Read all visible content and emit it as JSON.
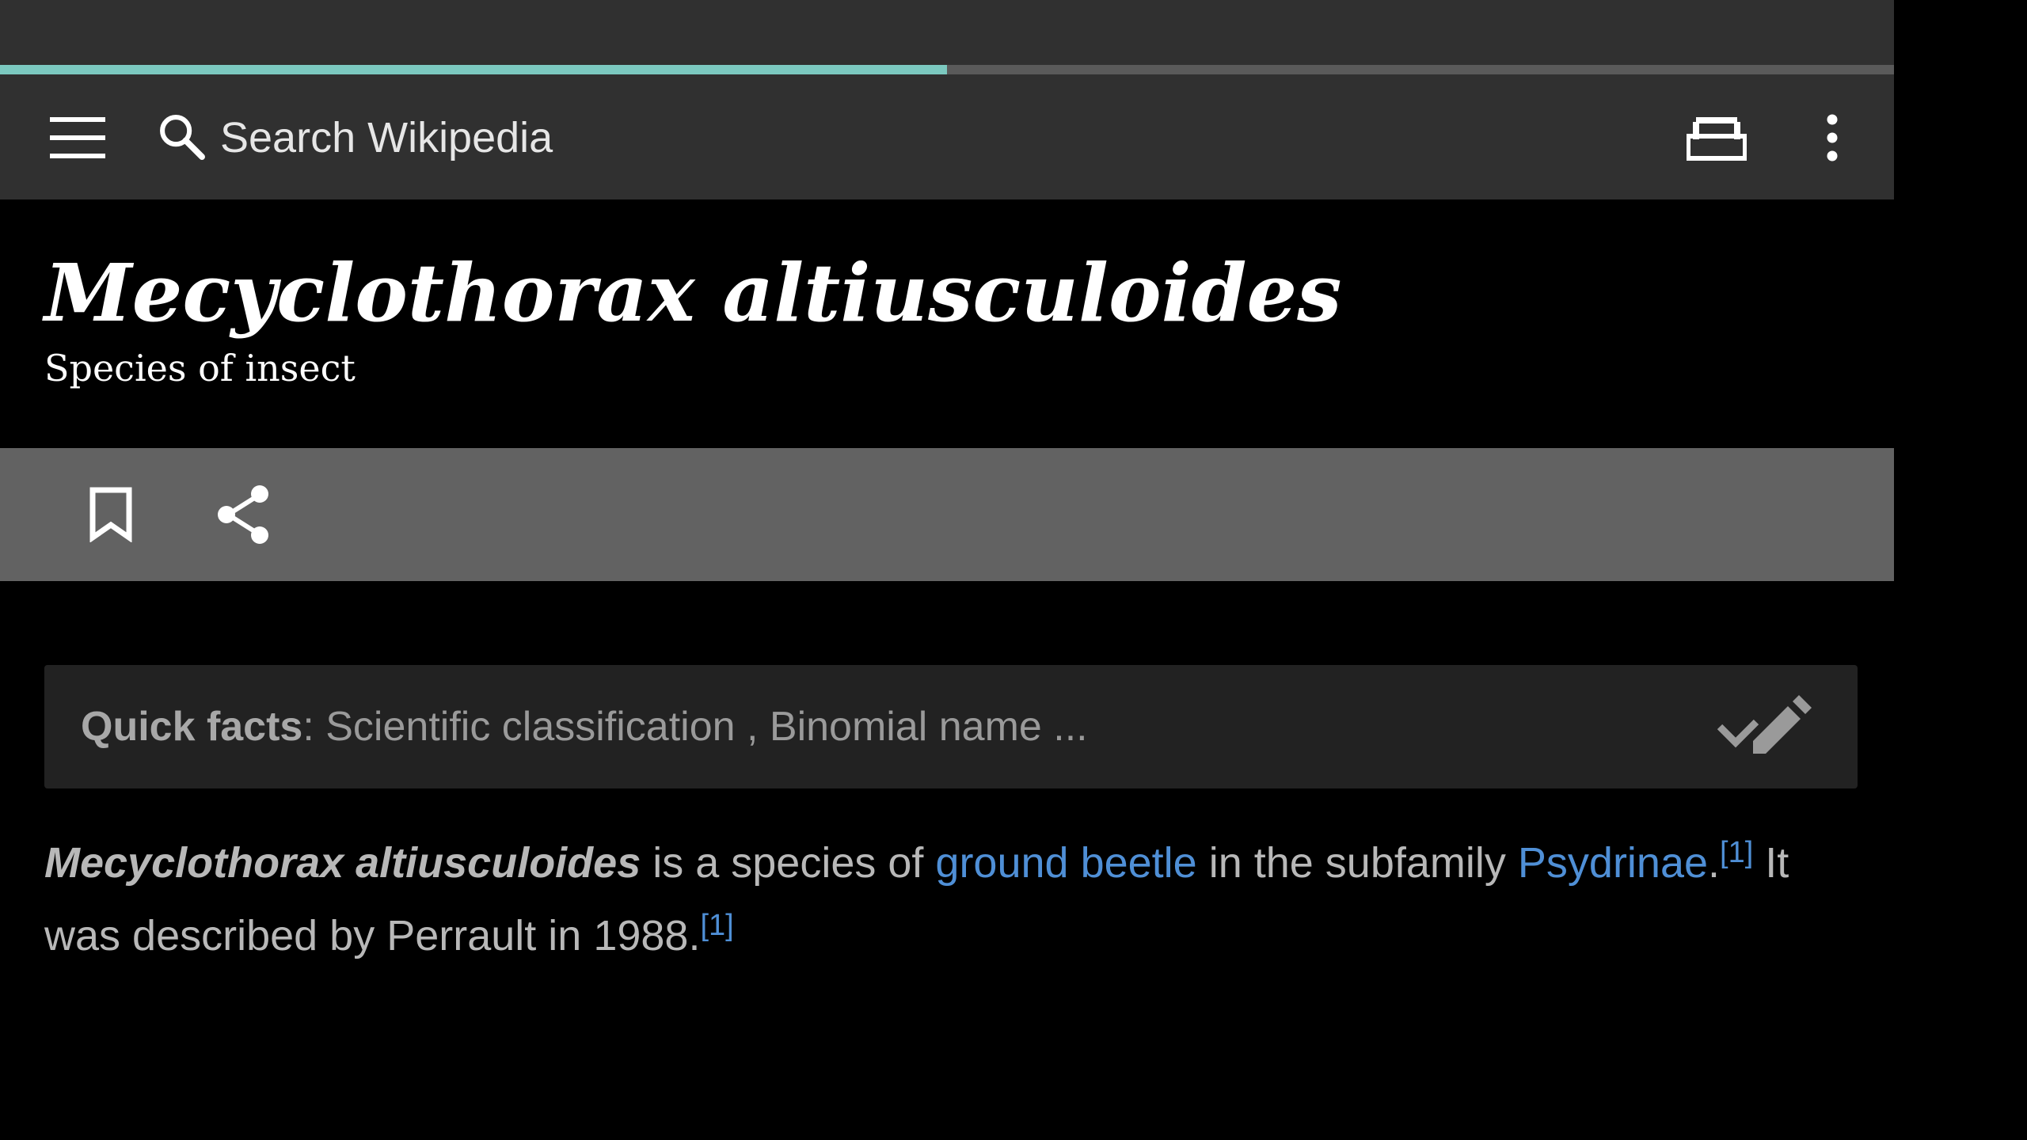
{
  "page_progress": 0.5,
  "colors": {
    "progress": "#7cc9c0",
    "link": "#4f8fd6",
    "toolbar": "#303030",
    "action_bar": "#626262"
  },
  "toolbar": {
    "menu_icon": "hamburger-menu-icon",
    "search_icon": "search-icon",
    "search_placeholder": "Search Wikipedia",
    "reading_list_icon": "reading-list-icon",
    "overflow_icon": "more-vertical-icon"
  },
  "article": {
    "title": "Mecyclothorax altiusculoides",
    "description": "Species of insect",
    "actions": {
      "bookmark_icon": "bookmark-icon",
      "share_icon": "share-icon"
    },
    "quick_facts": {
      "label": "Quick facts",
      "text": ": Scientific classification , Binomial name ...",
      "edit_icon": "edit-pencil-icon"
    },
    "body": {
      "subject": "Mecyclothorax altiusculoides",
      "text1": " is a species of ",
      "link1": "ground beetle",
      "text2": " in the subfamily ",
      "link2": "Psydrinae",
      "text3": ".",
      "ref1": "[1]",
      "text4": " It was described by Perrault in 1988.",
      "ref2": "[1]"
    }
  }
}
